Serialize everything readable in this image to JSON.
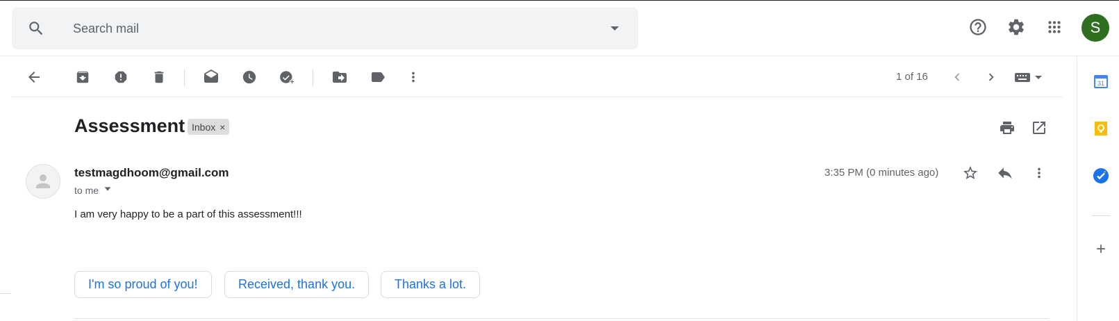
{
  "header": {
    "search_placeholder": "Search mail",
    "avatar_letter": "S",
    "avatar_color": "#2f6e1f"
  },
  "toolbar": {
    "pager_text": "1 of 16",
    "icons": [
      "back-arrow-icon",
      "archive-icon",
      "report-spam-icon",
      "delete-icon",
      "mark-unread-icon",
      "snooze-icon",
      "add-to-tasks-icon",
      "move-to-icon",
      "label-icon",
      "more-vert-icon",
      "newer-icon",
      "older-icon",
      "input-tools-icon"
    ]
  },
  "email": {
    "subject": "Assessment",
    "label_chip": "Inbox",
    "label_chip_close": "×",
    "sender": "testmagdhoom@gmail.com",
    "recipient_text": "to me",
    "time": "3:35 PM (0 minutes ago)",
    "body": "I am very happy to be a part of this assessment!!!"
  },
  "smart_replies": [
    "I'm so proud of you!",
    "Received, thank you.",
    "Thanks a lot."
  ],
  "side_panel": {
    "calendar_day": "31",
    "icons": [
      "calendar-icon",
      "keep-icon",
      "tasks-icon",
      "add-addon-icon"
    ],
    "colors": {
      "calendar": "#4285f4",
      "keep": "#fbbc04",
      "tasks": "#1a73e8"
    }
  },
  "colors": {
    "accent_blue": "#1a73e8",
    "search_bg": "#f1f3f4",
    "icon_gray": "#5f6368"
  }
}
